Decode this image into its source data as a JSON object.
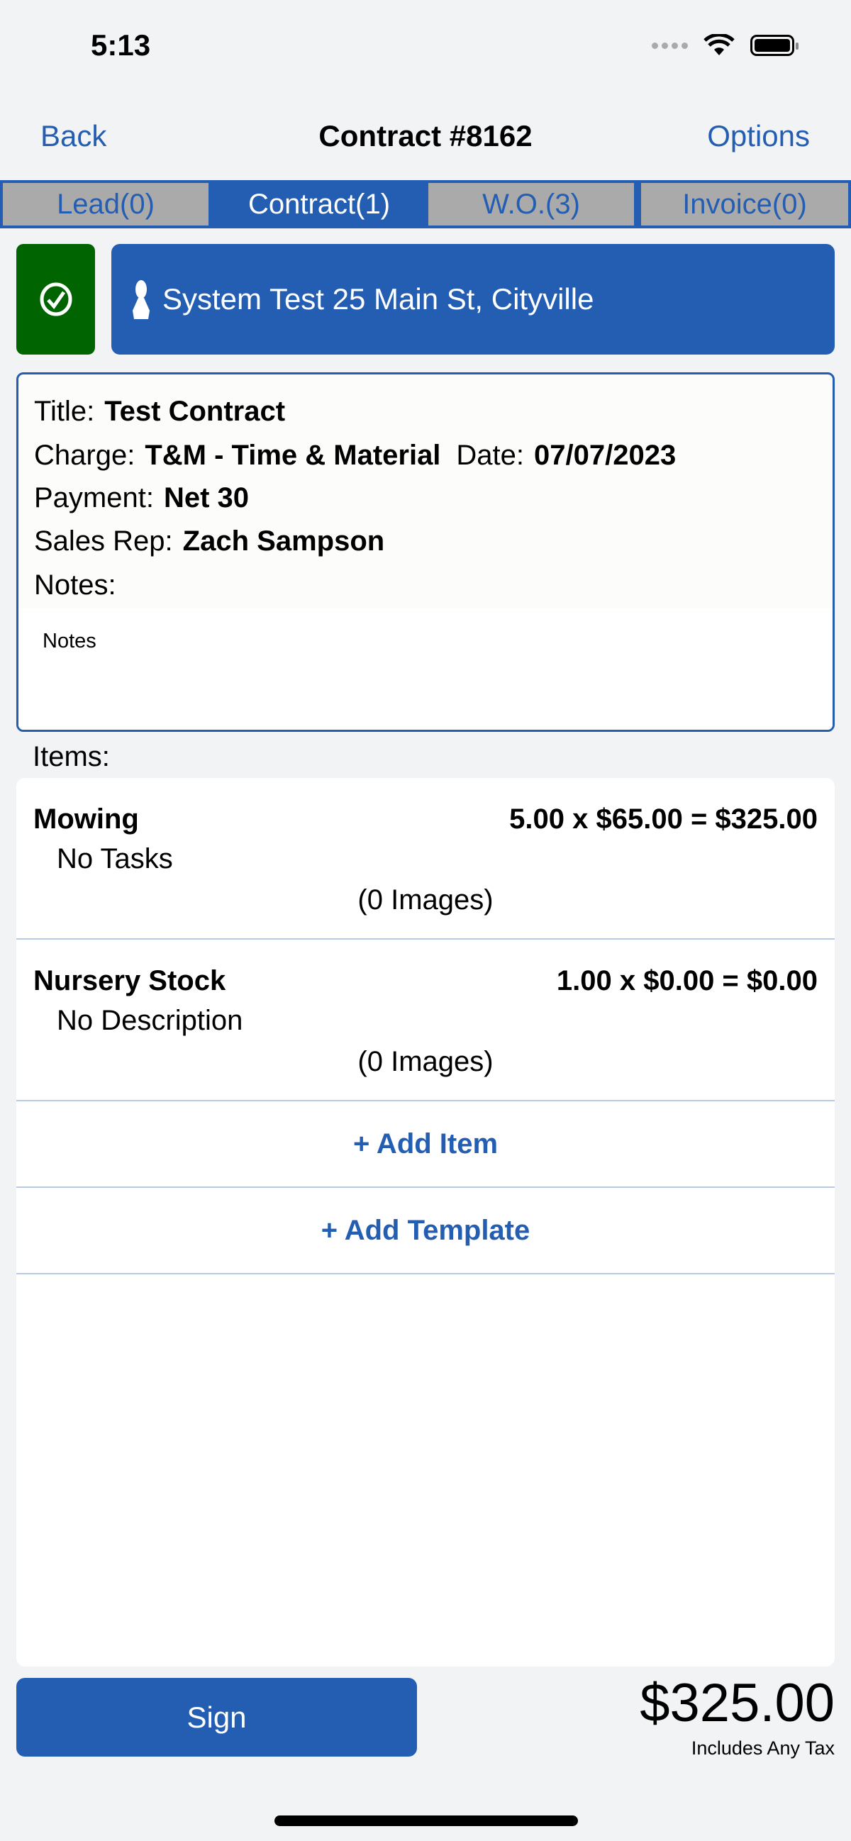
{
  "status_bar": {
    "time": "5:13"
  },
  "nav": {
    "back": "Back",
    "title": "Contract #8162",
    "options": "Options"
  },
  "tabs": [
    {
      "label": "Lead(0)"
    },
    {
      "label": "Contract(1)",
      "active": true
    },
    {
      "label": "W.O.(3)"
    },
    {
      "label": "Invoice(0)"
    }
  ],
  "customer": {
    "label": "System Test 25 Main St, Cityville"
  },
  "details": {
    "title_label": "Title:",
    "title": "Test Contract",
    "charge_label": "Charge:",
    "charge": "T&M - Time & Material",
    "date_label": "Date:",
    "date": "07/07/2023",
    "payment_label": "Payment:",
    "payment": "Net 30",
    "rep_label": "Sales Rep:",
    "rep": "Zach Sampson",
    "notes_label": "Notes:",
    "notes": "Notes"
  },
  "items_label": "Items:",
  "items": [
    {
      "name": "Mowing",
      "calc": "5.00 x $65.00 = $325.00",
      "sub": "No Tasks",
      "images": "(0 Images)"
    },
    {
      "name": "Nursery Stock",
      "calc": "1.00 x $0.00 = $0.00",
      "sub": "No Description",
      "images": "(0 Images)"
    }
  ],
  "actions": {
    "add_item": "+ Add Item",
    "add_template": "+ Add Template",
    "sign": "Sign"
  },
  "total": {
    "amount": "$325.00",
    "note": "Includes Any Tax"
  },
  "colors": {
    "accent": "#245eb3",
    "tab_inactive": "#aaaaaa",
    "status_green": "#006400"
  }
}
